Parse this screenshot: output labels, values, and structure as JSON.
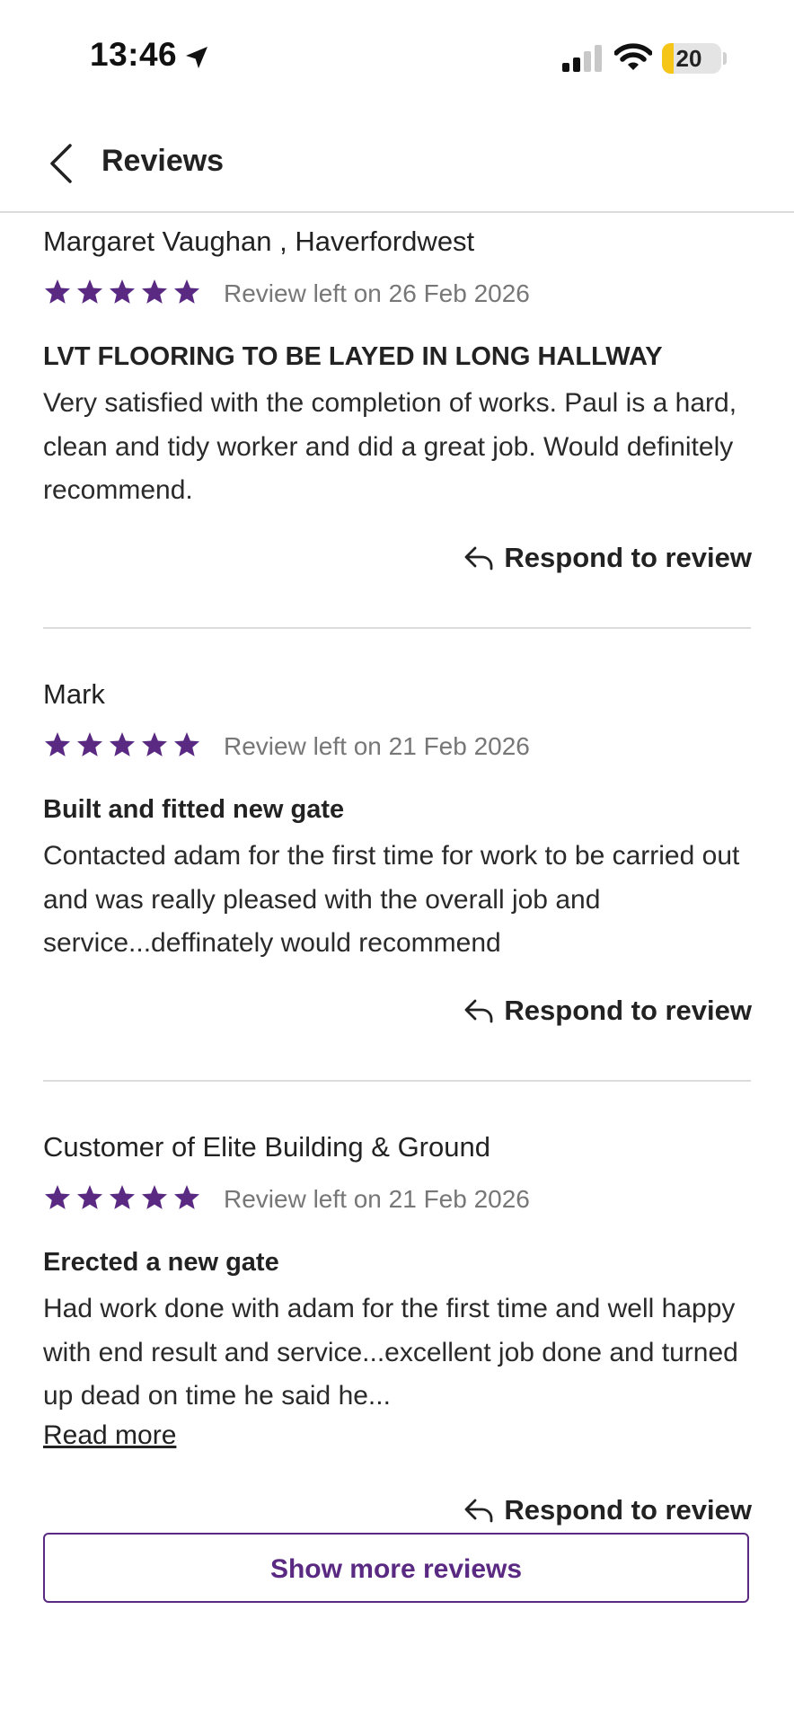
{
  "status": {
    "time": "13:46",
    "battery": "20",
    "battery_level": 0.2
  },
  "header": {
    "title": "Reviews"
  },
  "reviews": [
    {
      "name": "Margaret Vaughan , Haverfordwest",
      "rating": 5,
      "date": "Review left on 26 Feb 2026",
      "title": "LVT FLOORING TO BE LAYED IN LONG HALLWAY",
      "body": "Very satisfied with the completion of works. Paul is a hard, clean and tidy worker and did a great job. Would definitely recommend.",
      "respond_label": "Respond to review"
    },
    {
      "name": "Mark",
      "rating": 5,
      "date": "Review left on 21 Feb 2026",
      "title": "Built and fitted new gate",
      "body": "Contacted adam for the first time for work to be carried out and was really pleased with the overall job and service...deffinately would recommend",
      "respond_label": "Respond to review"
    },
    {
      "name": "Customer of Elite Building & Ground",
      "rating": 5,
      "date": "Review left on 21 Feb 2026",
      "title": "Erected a new gate",
      "body": "Had work done with adam for the first time and well happy with end result and service...excellent job done and turned up dead on time he said he...",
      "read_more": "Read more",
      "respond_label": "Respond to review"
    }
  ],
  "show_more_label": "Show more reviews",
  "colors": {
    "accent": "#5a2a82",
    "star": "#5a2a82",
    "divider": "#dcdcdc",
    "battery": "#f5c518"
  }
}
